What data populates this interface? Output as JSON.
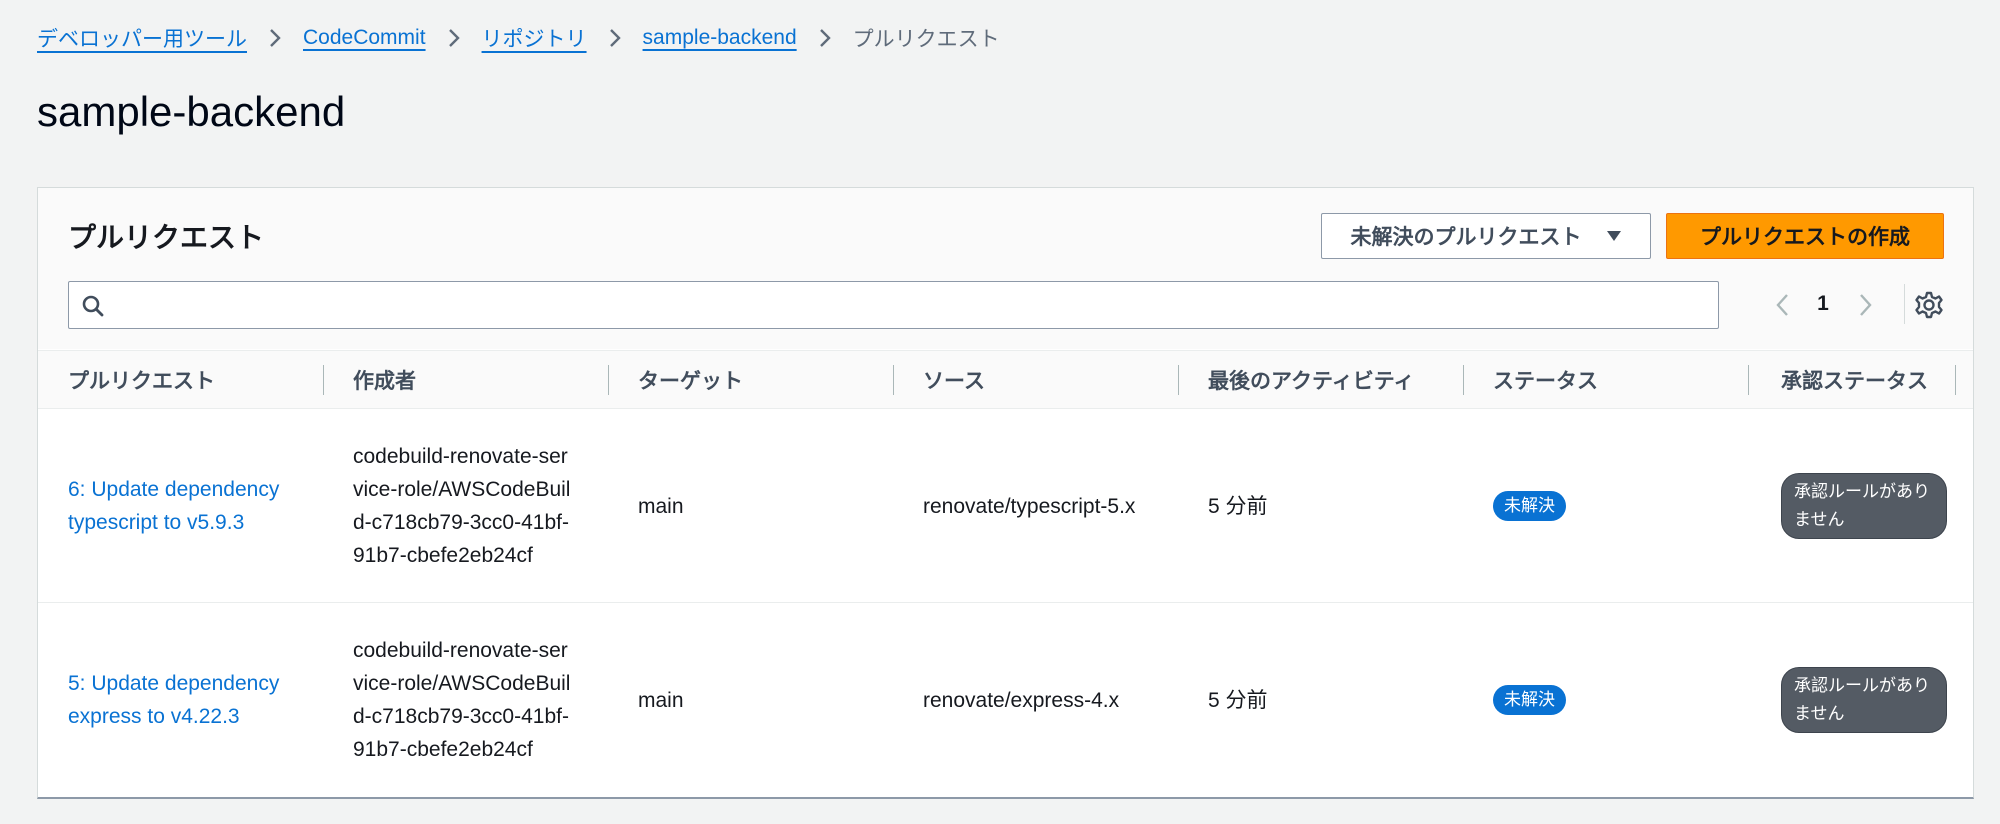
{
  "breadcrumb": {
    "items": [
      "デベロッパー用ツール",
      "CodeCommit",
      "リポジトリ",
      "sample-backend"
    ],
    "current": "プルリクエスト"
  },
  "page": {
    "title": "sample-backend"
  },
  "panel": {
    "title": "プルリクエスト",
    "filter_select": {
      "selected": "未解決のプルリクエスト"
    },
    "create_button_label": "プルリクエストの作成",
    "search": {
      "value": "",
      "placeholder": ""
    },
    "pagination": {
      "current_page": "1"
    }
  },
  "table": {
    "columns": [
      "プルリクエスト",
      "作成者",
      "ターゲット",
      "ソース",
      "最後のアクティビティ",
      "ステータス",
      "承認ステータス"
    ],
    "rows": [
      {
        "pull_request": "6: Update dependency typescript to v5.9.3",
        "author": "codebuild-renovate-service-role/AWSCodeBuild-c718cb79-3cc0-41bf-91b7-cbefe2eb24cf",
        "target": "main",
        "source": "renovate/typescript-5.x",
        "last_activity": "5 分前",
        "status": "未解決",
        "approval_status": "承認ルールがありません"
      },
      {
        "pull_request": "5: Update dependency express to v4.22.3",
        "author": "codebuild-renovate-service-role/AWSCodeBuild-c718cb79-3cc0-41bf-91b7-cbefe2eb24cf",
        "target": "main",
        "source": "renovate/express-4.x",
        "last_activity": "5 分前",
        "status": "未解決",
        "approval_status": "承認ルールがありません"
      }
    ]
  },
  "colors": {
    "link": "#0972d3",
    "primary_button": "#ff9900",
    "status_open": "#0972d3",
    "approval_badge": "#545b64",
    "background": "#f2f3f3"
  }
}
